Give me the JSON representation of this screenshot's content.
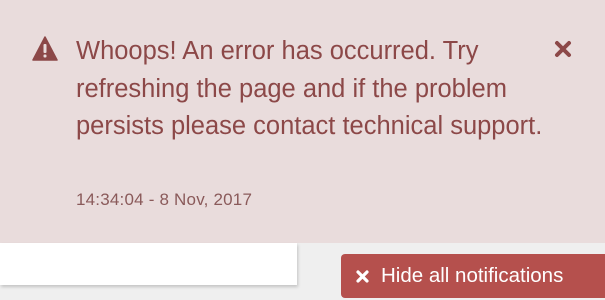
{
  "notification": {
    "message": "Whoops! An error has occurred. Try refreshing the page and if the problem persists please contact technical support.",
    "timestamp": "14:34:04 - 8 Nov, 2017",
    "icon": "warning-icon",
    "close_icon": "close-icon"
  },
  "actions": {
    "hide_all_label": "Hide all notifications",
    "hide_all_icon": "close-icon"
  },
  "colors": {
    "notification_bg": "#e9dcdc",
    "notification_text": "#8c4848",
    "button_bg": "#b5504d",
    "button_text": "#ffffff"
  }
}
